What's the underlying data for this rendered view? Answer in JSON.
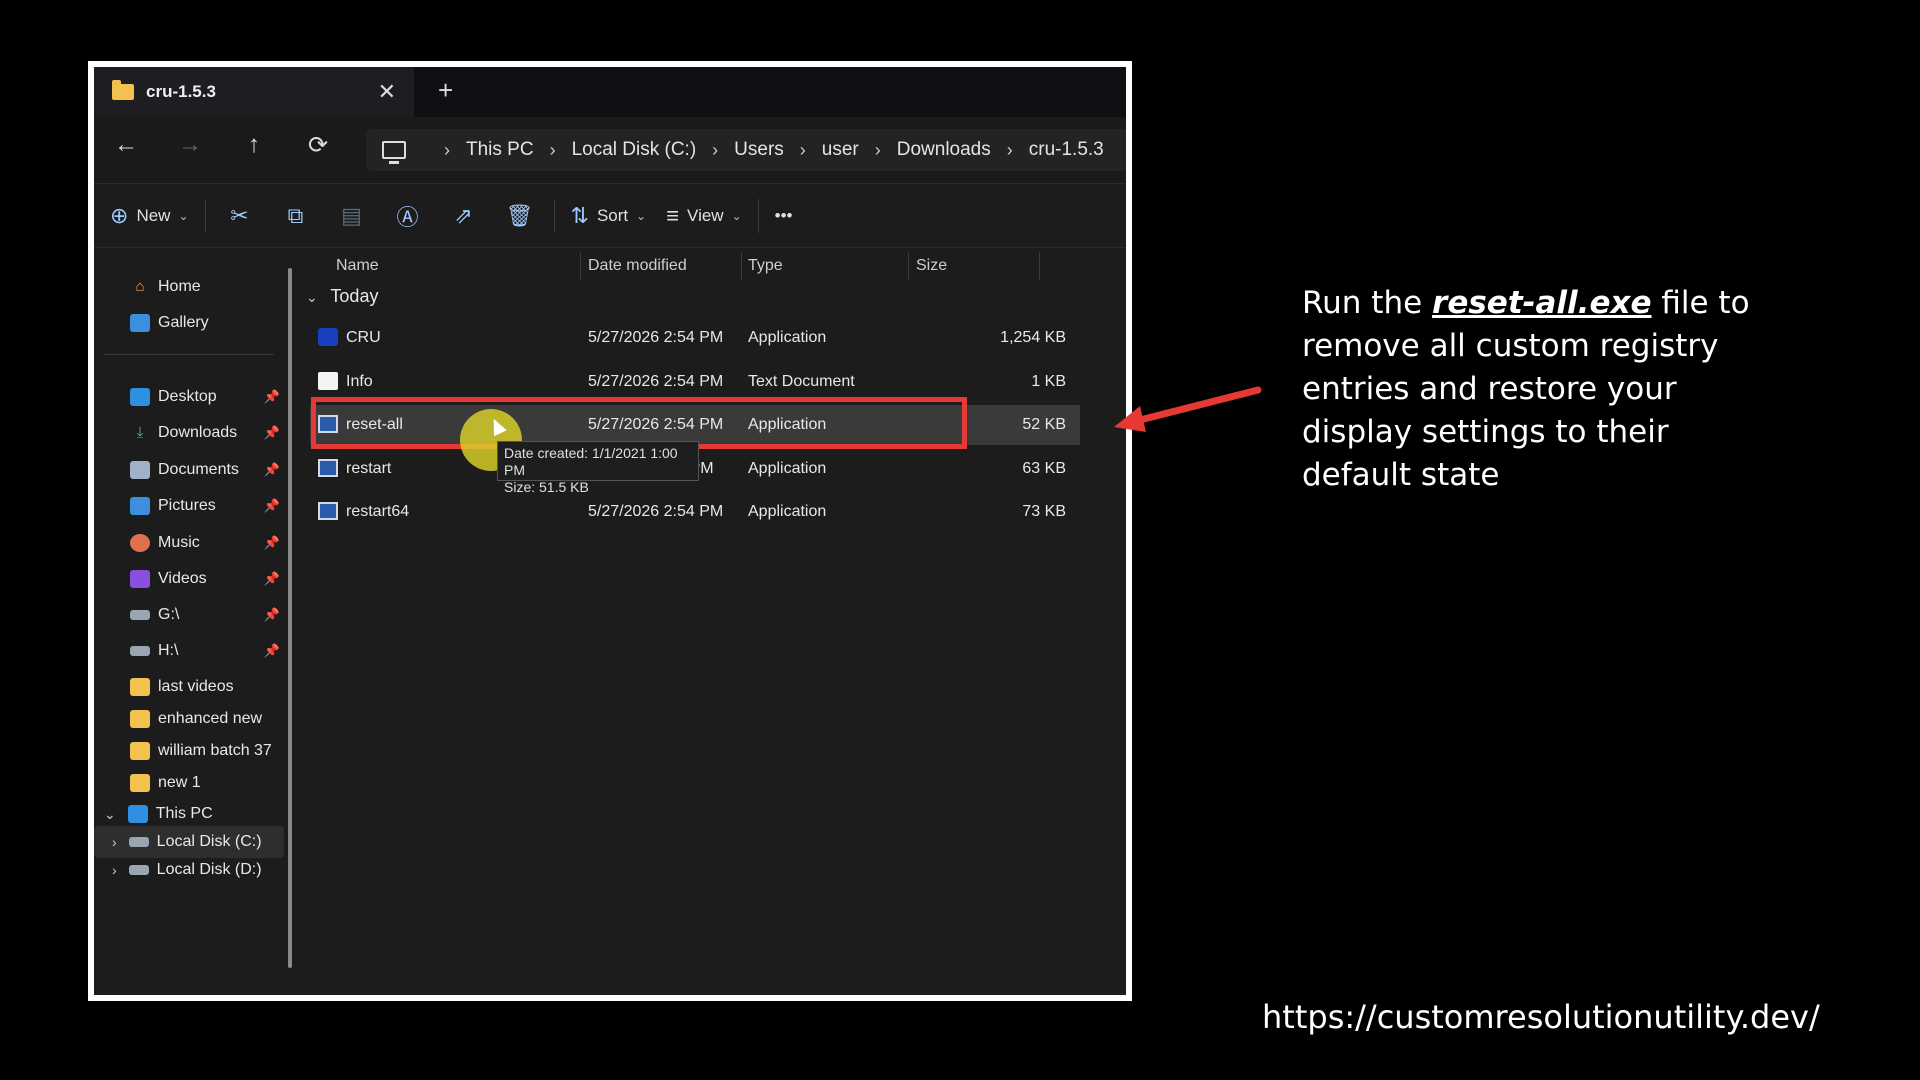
{
  "window": {
    "tab_title": "cru-1.5.3",
    "close_glyph": "✕",
    "newtab_glyph": "+"
  },
  "nav": {
    "back": "←",
    "forward": "→",
    "up": "↑",
    "refresh": "⟳",
    "breadcrumb": [
      "This PC",
      "Local Disk (C:)",
      "Users",
      "user",
      "Downloads",
      "cru-1.5.3"
    ]
  },
  "toolbar": {
    "new_label": "New",
    "sort_label": "Sort",
    "view_label": "View",
    "more": "•••",
    "icons": [
      "cut-icon",
      "copy-icon",
      "paste-icon",
      "rename-icon",
      "share-icon",
      "delete-icon"
    ]
  },
  "sidebar": {
    "top": [
      {
        "label": "Home",
        "icon": "home-icon"
      },
      {
        "label": "Gallery",
        "icon": "gallery-icon"
      }
    ],
    "pinned": [
      {
        "label": "Desktop",
        "icon": "desktop-icon"
      },
      {
        "label": "Downloads",
        "icon": "download-icon"
      },
      {
        "label": "Documents",
        "icon": "documents-icon"
      },
      {
        "label": "Pictures",
        "icon": "pictures-icon"
      },
      {
        "label": "Music",
        "icon": "music-icon"
      },
      {
        "label": "Videos",
        "icon": "videos-icon"
      },
      {
        "label": "G:\\",
        "icon": "drive-icon"
      },
      {
        "label": "H:\\",
        "icon": "drive-icon"
      }
    ],
    "folders": [
      "last videos",
      "enhanced new",
      "william batch 37",
      "new 1"
    ],
    "this_pc": "This PC",
    "drives": [
      "Local Disk (C:)",
      "Local Disk (D:)"
    ]
  },
  "list": {
    "columns": [
      "Name",
      "Date modified",
      "Type",
      "Size"
    ],
    "group": "Today",
    "rows": [
      {
        "name": "CRU",
        "date": "5/27/2026 2:54 PM",
        "type": "Application",
        "size": "1,254 KB"
      },
      {
        "name": "Info",
        "date": "5/27/2026 2:54 PM",
        "type": "Text Document",
        "size": "1 KB"
      },
      {
        "name": "reset-all",
        "date": "5/27/2026 2:54 PM",
        "type": "Application",
        "size": "52 KB"
      },
      {
        "name": "restart",
        "date": "2:54 PM",
        "type": "Application",
        "size": "63 KB"
      },
      {
        "name": "restart64",
        "date": "5/27/2026 2:54 PM",
        "type": "Application",
        "size": "73 KB"
      }
    ],
    "tooltip": {
      "line1": "Date created: 1/1/2021 1:00 PM",
      "line2": "Size: 51.5 KB"
    }
  },
  "caption": {
    "pre": "Run the ",
    "emph": "reset-all.exe",
    "post": " file to remove all custom registry entries and restore your display settings to their default state"
  },
  "url": "https://customresolutionutility.dev/",
  "colors": {
    "highlight": "#e53935",
    "cursor_glow": "#dcd228",
    "folder": "#f2c14e"
  }
}
